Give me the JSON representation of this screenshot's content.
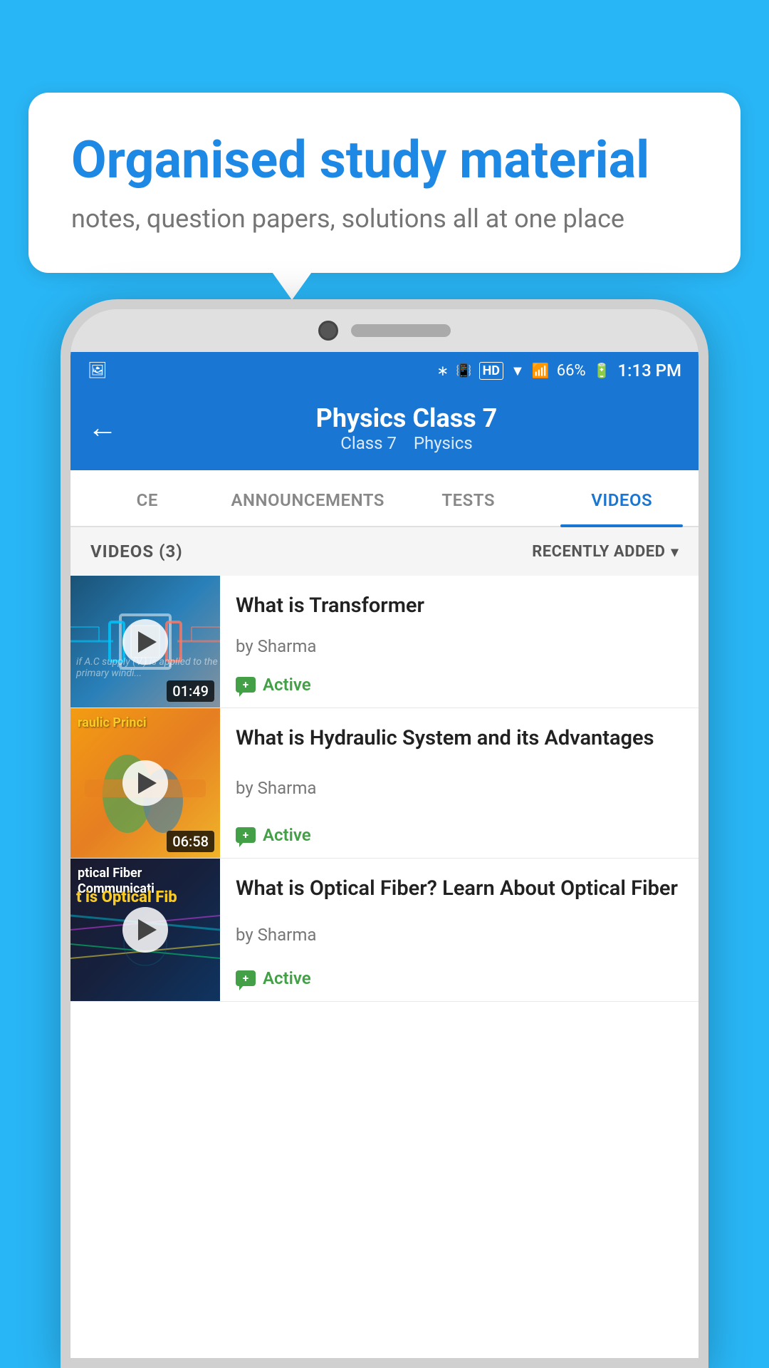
{
  "page": {
    "background_color": "#29b6f6"
  },
  "speech_bubble": {
    "heading": "Organised study material",
    "subtext": "notes, question papers, solutions all at one place"
  },
  "status_bar": {
    "time": "1:13 PM",
    "battery": "66%",
    "signal_icons": "status icons"
  },
  "app_header": {
    "title": "Physics Class 7",
    "subtitle_class": "Class 7",
    "subtitle_subject": "Physics",
    "back_label": "←"
  },
  "tabs": [
    {
      "label": "CE",
      "active": false
    },
    {
      "label": "ANNOUNCEMENTS",
      "active": false
    },
    {
      "label": "TESTS",
      "active": false
    },
    {
      "label": "VIDEOS",
      "active": true
    }
  ],
  "videos_section": {
    "count_label": "VIDEOS (3)",
    "sort_label": "RECENTLY ADDED"
  },
  "videos": [
    {
      "title": "What is  Transformer",
      "author": "by Sharma",
      "status": "Active",
      "duration": "01:49",
      "thumb_type": "transformer",
      "thumb_label": ""
    },
    {
      "title": "What is Hydraulic System and its Advantages",
      "author": "by Sharma",
      "status": "Active",
      "duration": "06:58",
      "thumb_type": "hydraulic",
      "thumb_label": "raulic Princi"
    },
    {
      "title": "What is Optical Fiber? Learn About Optical Fiber",
      "author": "by Sharma",
      "status": "Active",
      "duration": "",
      "thumb_type": "optical",
      "thumb_label": "ptical Fiber Communicati"
    }
  ]
}
